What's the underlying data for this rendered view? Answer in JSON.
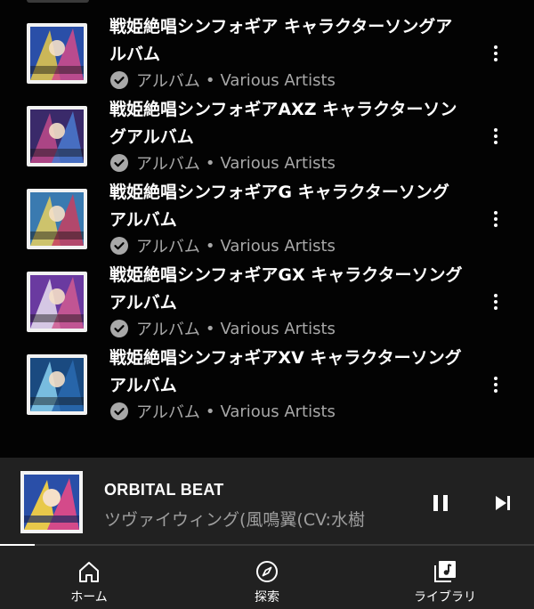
{
  "albums": [
    {
      "title": "戦姫絶唱シンフォギア キャラクターソングアルバム",
      "type": "アルバム",
      "separator": "•",
      "artist": "Various Artists",
      "thumb_colors": [
        "#2a4fa8",
        "#e8c94a",
        "#d44a8a"
      ]
    },
    {
      "title": "戦姫絶唱シンフォギアAXZ キャラクターソングアルバム",
      "type": "アルバム",
      "separator": "•",
      "artist": "Various Artists",
      "thumb_colors": [
        "#3a2a6a",
        "#c04a8a",
        "#4a7ad0"
      ]
    },
    {
      "title": "戦姫絶唱シンフォギアG キャラクターソングアルバム",
      "type": "アルバム",
      "separator": "•",
      "artist": "Various Artists",
      "thumb_colors": [
        "#3a7ab0",
        "#e8d060",
        "#c84060"
      ]
    },
    {
      "title": "戦姫絶唱シンフォギアGX キャラクターソングアルバム",
      "type": "アルバム",
      "separator": "•",
      "artist": "Various Artists",
      "thumb_colors": [
        "#6a3aa0",
        "#e8e0f0",
        "#d05a90"
      ]
    },
    {
      "title": "戦姫絶唱シンフォギアXV キャラクターソングアルバム",
      "type": "アルバム",
      "separator": "•",
      "artist": "Various Artists",
      "thumb_colors": [
        "#1a4a80",
        "#8ad0f0",
        "#2a6ab0"
      ]
    }
  ],
  "player": {
    "title": "ORBITAL BEAT",
    "artist": "ツヴァイウィング(風鳴翼(CV:水樹",
    "progress": 0.065
  },
  "nav": {
    "home": "ホーム",
    "explore": "探索",
    "library": "ライブラリ"
  }
}
